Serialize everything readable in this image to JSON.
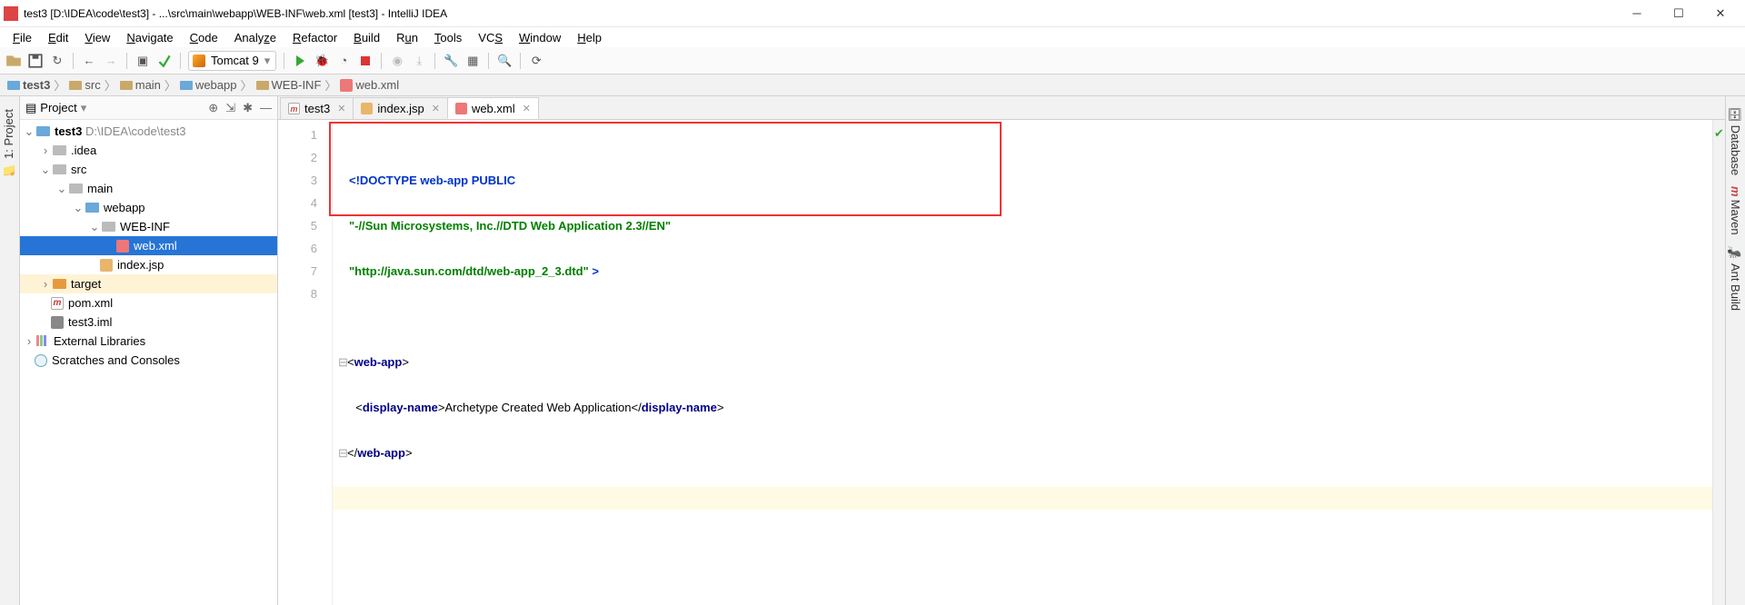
{
  "window": {
    "title": "test3 [D:\\IDEA\\code\\test3] - ...\\src\\main\\webapp\\WEB-INF\\web.xml [test3] - IntelliJ IDEA"
  },
  "menu": [
    "File",
    "Edit",
    "View",
    "Navigate",
    "Code",
    "Analyze",
    "Refactor",
    "Build",
    "Run",
    "Tools",
    "VCS",
    "Window",
    "Help"
  ],
  "runConfig": "Tomcat 9",
  "breadcrumb": [
    "test3",
    "src",
    "main",
    "webapp",
    "WEB-INF",
    "web.xml"
  ],
  "projectPanel": {
    "title": "Project"
  },
  "sidebarLeft": {
    "label": "1: Project"
  },
  "sidebarRight": [
    "Database",
    "Maven",
    "Ant Build"
  ],
  "tree": {
    "root": {
      "name": "test3",
      "path": "D:\\IDEA\\code\\test3"
    },
    "idea": ".idea",
    "src": "src",
    "main": "main",
    "webapp": "webapp",
    "webinf": "WEB-INF",
    "webxml": "web.xml",
    "indexjsp": "index.jsp",
    "target": "target",
    "pom": "pom.xml",
    "iml": "test3.iml",
    "extlib": "External Libraries",
    "scratch": "Scratches and Consoles"
  },
  "tabs": [
    {
      "label": "test3",
      "type": "m"
    },
    {
      "label": "index.jsp",
      "type": "jsp"
    },
    {
      "label": "web.xml",
      "type": "xml",
      "active": true
    }
  ],
  "code": {
    "l1a": "<!DOCTYPE ",
    "l1b": "web-app ",
    "l1c": "PUBLIC",
    "l2": "\"-//Sun Microsystems, Inc.//DTD Web Application 2.3//EN\"",
    "l3a": "\"http://java.sun.com/dtd/web-app_2_3.dtd\"",
    "l3b": " >",
    "l5o": "<",
    "l5t": "web-app",
    "l5c": ">",
    "l6o": "<",
    "l6t1": "display-name",
    "l6c1": ">",
    "l6txt": "Archetype Created Web Application",
    "l6o2": "</",
    "l6t2": "display-name",
    "l6c2": ">",
    "l7o": "</",
    "l7t": "web-app",
    "l7c": ">"
  },
  "lineNumbers": [
    1,
    2,
    3,
    4,
    5,
    6,
    7,
    8
  ]
}
